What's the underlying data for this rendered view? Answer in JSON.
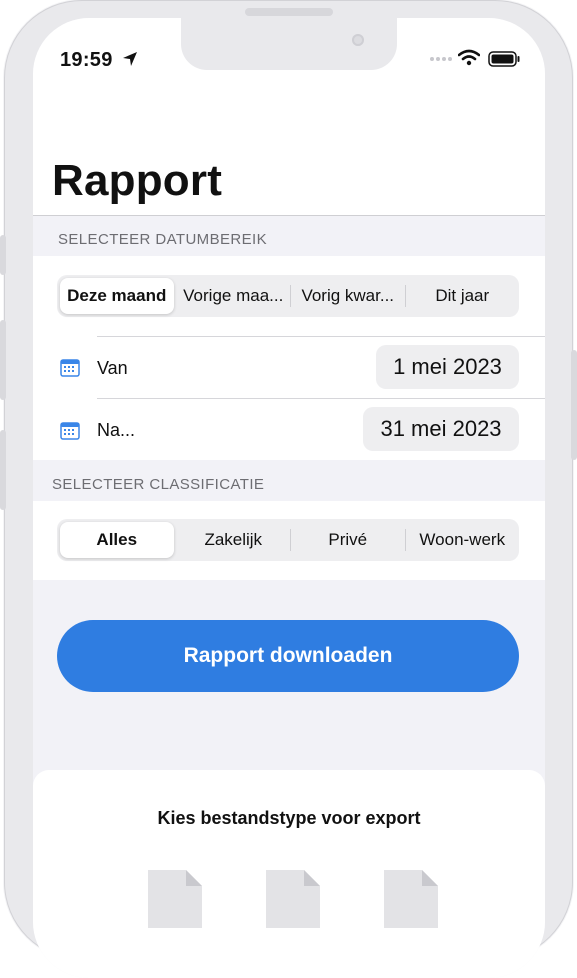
{
  "status_bar": {
    "time": "19:59"
  },
  "header": {
    "title": "Rapport"
  },
  "date_range": {
    "section_label": "SELECTEER DATUMBEREIK",
    "segments": [
      "Deze maand",
      "Vorige maa...",
      "Vorig kwar...",
      "Dit jaar"
    ],
    "selected_index": 0,
    "from_label": "Van",
    "from_value": "1 mei 2023",
    "to_label": "Na...",
    "to_value": "31 mei 2023"
  },
  "classification": {
    "section_label": "SELECTEER CLASSIFICATIE",
    "segments": [
      "Alles",
      "Zakelijk",
      "Privé",
      "Woon-werk"
    ],
    "selected_index": 0
  },
  "download": {
    "label": "Rapport downloaden"
  },
  "export": {
    "title": "Kies bestandstype voor export",
    "file_types": 3
  },
  "colors": {
    "accent": "#2f7de1",
    "calendar_icon": "#3a86e8"
  }
}
